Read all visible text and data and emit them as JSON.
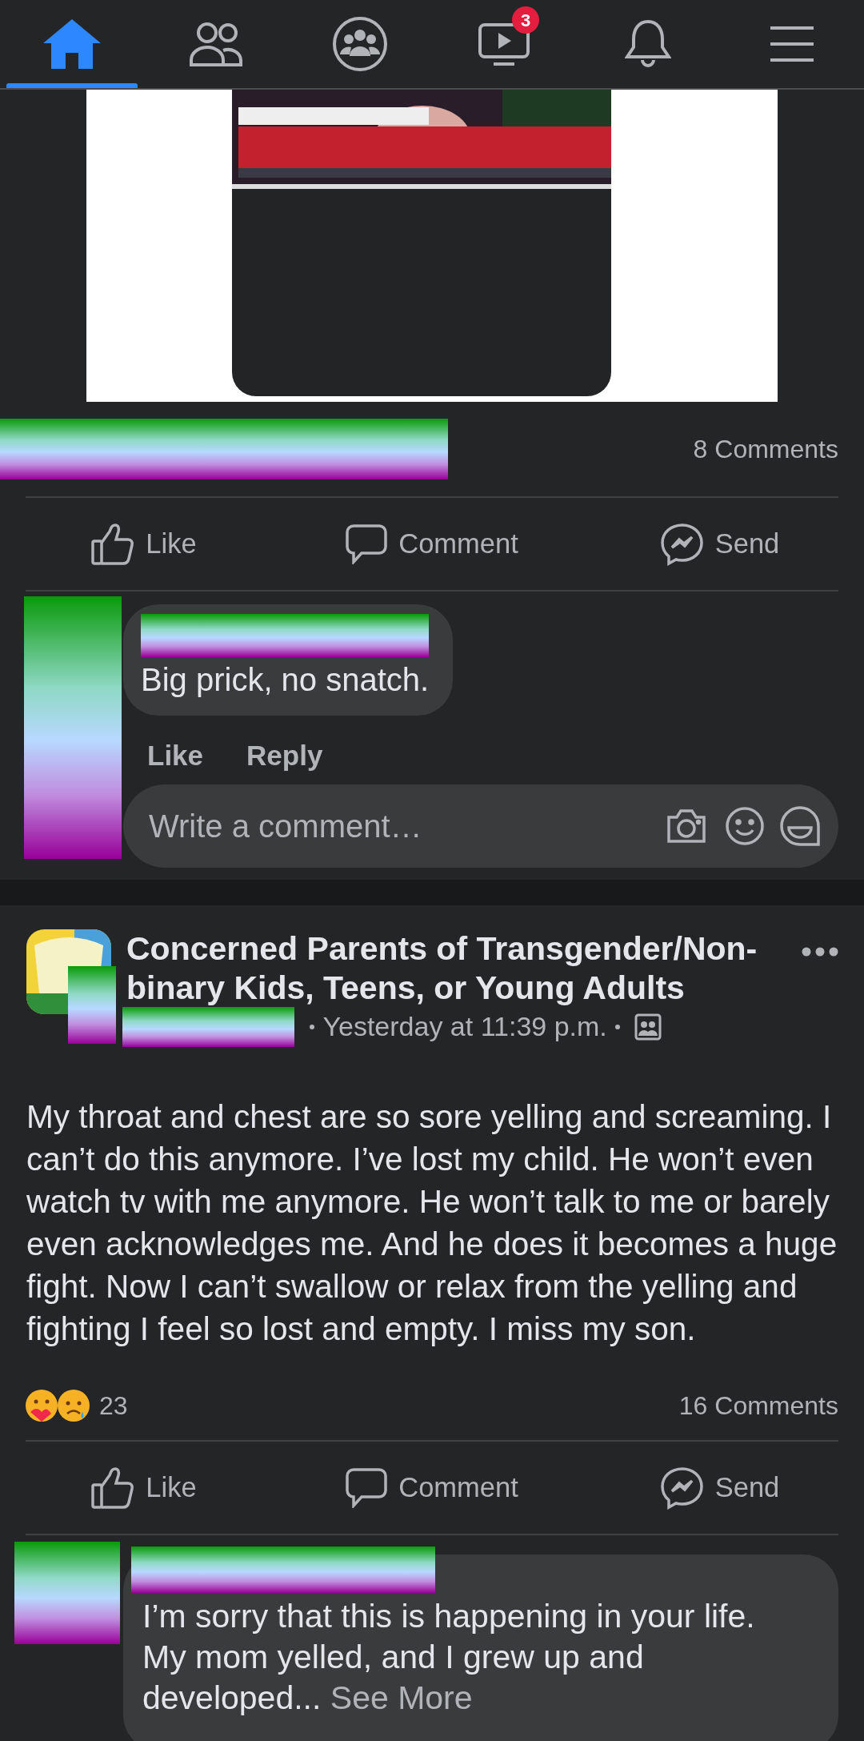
{
  "nav": {
    "tabs": [
      {
        "kind": "home",
        "selected": true
      },
      {
        "kind": "friends",
        "selected": false
      },
      {
        "kind": "groups",
        "selected": false
      },
      {
        "kind": "watch",
        "selected": false,
        "badge": "3"
      },
      {
        "kind": "notifications",
        "selected": false
      },
      {
        "kind": "menu",
        "selected": false
      }
    ]
  },
  "posts": [
    {
      "comments_count": "8 Comments",
      "actions": [
        "Like",
        "Comment",
        "Send"
      ],
      "comment": {
        "text": "Big prick, no snatch.",
        "actions": [
          "Like",
          "Reply"
        ]
      },
      "comment_box": {
        "placeholder": "Write a comment…"
      }
    },
    {
      "group": "Concerned Parents of Transgender/Non-binary Kids, Teens, or Young Adults",
      "time": "Yesterday at 11:39 p.m.",
      "body": "My throat and chest are so sore yelling and screaming. I can’t do this anymore. I’ve lost my child. He won’t even watch tv with me anymore. He won’t talk to me or barely even acknowledges me. And he does it becomes a huge fight. Now I can’t swallow or relax from the yelling and fighting I feel so lost and empty. I miss my son.",
      "reactions_count": "23",
      "comments_count": "16 Comments",
      "actions": [
        "Like",
        "Comment",
        "Send"
      ],
      "comment": {
        "text": "I’m sorry that this is happening in your life. My mom yelled, and I grew up and developed...",
        "see_more": "See More"
      }
    }
  ]
}
